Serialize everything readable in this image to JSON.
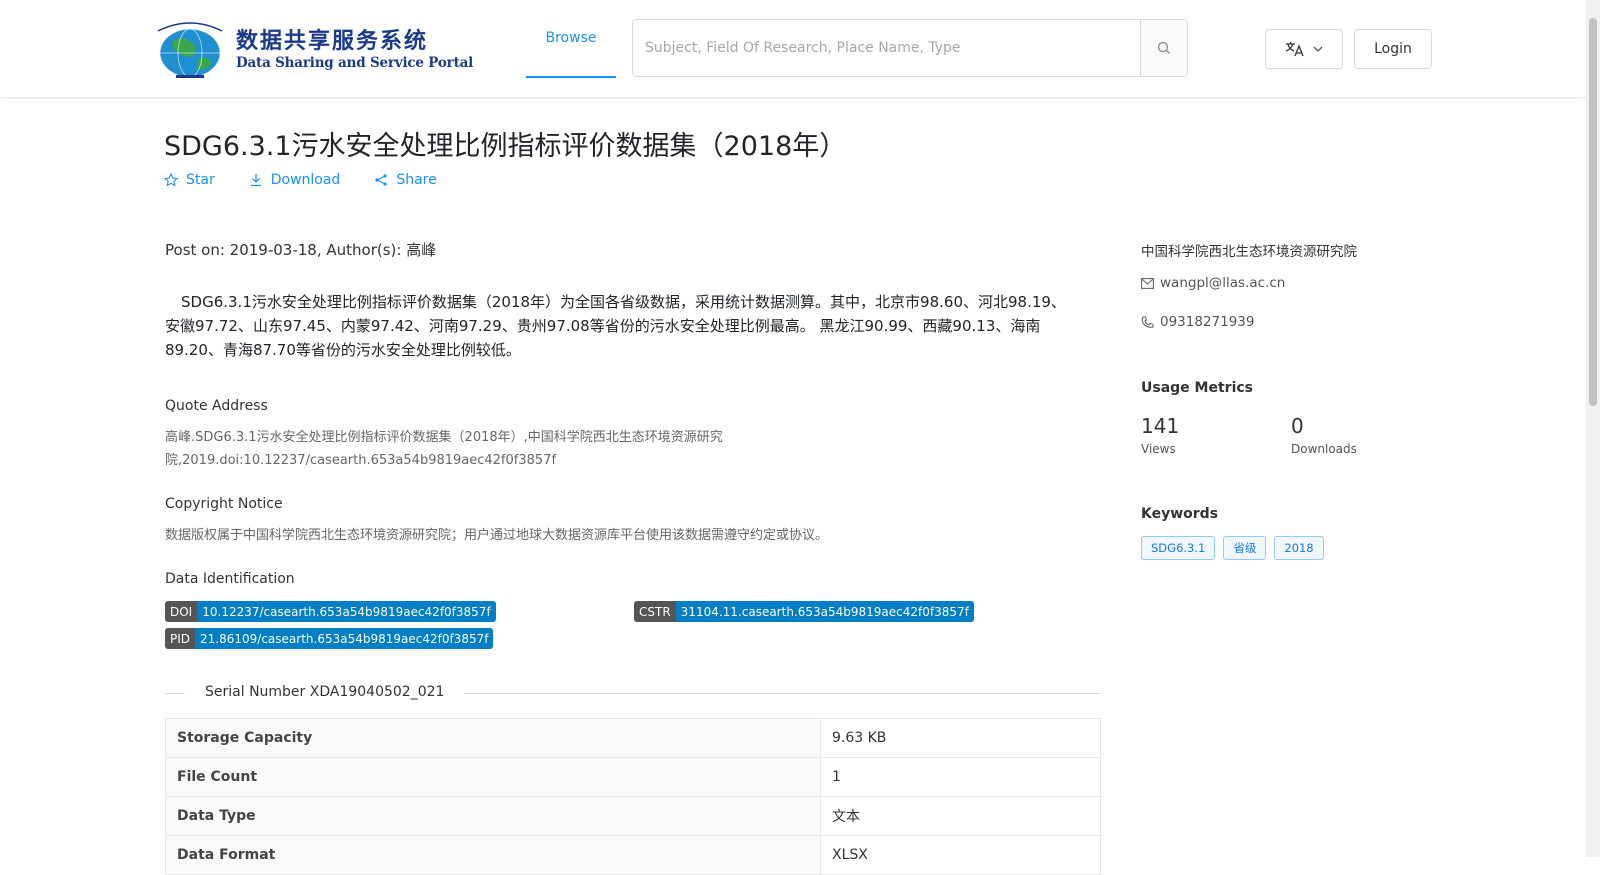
{
  "header": {
    "logo_cn": "数据共享服务系统",
    "logo_en": "Data Sharing and Service Portal",
    "nav_browse": "Browse",
    "search_placeholder": "Subject, Field Of Research, Place Name, Type",
    "login_label": "Login"
  },
  "dataset": {
    "title": "SDG6.3.1污水安全处理比例指标评价数据集（2018年）",
    "actions": {
      "star": "Star",
      "download": "Download",
      "share": "Share"
    },
    "post_line": "Post on: 2019-03-18, Author(s): 高峰",
    "description": "SDG6.3.1污水安全处理比例指标评价数据集（2018年）为全国各省级数据，采用统计数据测算。其中，北京市98.60、河北98.19、安徽97.72、山东97.45、内蒙97.42、河南97.29、贵州97.08等省份的污水安全处理比例最高。 黑龙江90.99、西藏90.13、海南89.20、青海87.70等省份的污水安全处理比例较低。",
    "quote_title": "Quote Address",
    "quote_text": "高峰.SDG6.3.1污水安全处理比例指标评价数据集（2018年）,中国科学院西北生态环境资源研究院,2019.doi:10.12237/casearth.653a54b9819aec42f0f3857f",
    "copyright_title": "Copyright Notice",
    "copyright_text": "数据版权属于中国科学院西北生态环境资源研究院；用户通过地球大数据资源库平台使用该数据需遵守约定或协议。",
    "identification_title": "Data Identification",
    "identifiers": [
      {
        "key": "DOI",
        "value": "10.12237/casearth.653a54b9819aec42f0f3857f"
      },
      {
        "key": "CSTR",
        "value": "31104.11.casearth.653a54b9819aec42f0f3857f"
      },
      {
        "key": "PID",
        "value": "21.86109/casearth.653a54b9819aec42f0f3857f"
      }
    ],
    "serial": "Serial Number XDA19040502_021",
    "table": [
      {
        "key": "Storage Capacity",
        "value": "9.63 KB"
      },
      {
        "key": "File Count",
        "value": "1"
      },
      {
        "key": "Data Type",
        "value": "文本"
      },
      {
        "key": "Data Format",
        "value": "XLSX"
      }
    ]
  },
  "sidebar": {
    "organization": "中国科学院西北生态环境资源研究院",
    "email": "wangpl@llas.ac.cn",
    "phone": "09318271939",
    "metrics_title": "Usage Metrics",
    "views_count": "141",
    "views_label": "Views",
    "downloads_count": "0",
    "downloads_label": "Downloads",
    "keywords_title": "Keywords",
    "keywords": [
      "SDG6.3.1",
      "省级",
      "2018"
    ]
  },
  "colors": {
    "accent": "#1890ff",
    "badge_key": "#555555",
    "badge_value": "#007ec6"
  }
}
